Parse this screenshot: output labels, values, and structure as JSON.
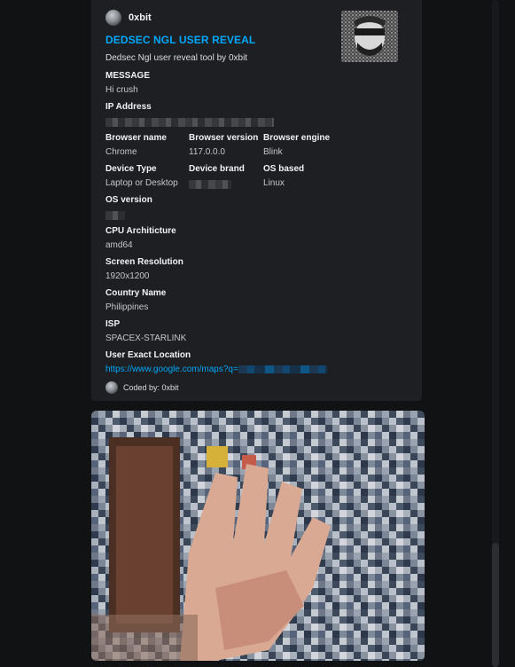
{
  "embed": {
    "author_name": "0xbit",
    "title": "DEDSEC NGL USER REVEAL",
    "description": "Dedsec Ngl user reveal tool by 0xbit",
    "fields": {
      "message": {
        "name": "MESSAGE",
        "value": "Hi crush"
      },
      "ip_address": {
        "name": "IP Address",
        "value": ""
      },
      "browser_name": {
        "name": "Browser name",
        "value": "Chrome"
      },
      "browser_version": {
        "name": "Browser version",
        "value": "117.0.0.0"
      },
      "browser_engine": {
        "name": "Browser engine",
        "value": "Blink"
      },
      "device_type": {
        "name": "Device Type",
        "value": "Laptop or Desktop"
      },
      "device_brand": {
        "name": "Device brand",
        "value": ""
      },
      "os_based": {
        "name": "OS based",
        "value": "Linux"
      },
      "os_version": {
        "name": "OS version",
        "value": ""
      },
      "cpu_architecture": {
        "name": "CPU Architicture",
        "value": "amd64"
      },
      "screen_resolution": {
        "name": "Screen Resolution",
        "value": "1920x1200"
      },
      "country_name": {
        "name": "Country Name",
        "value": "Philippines"
      },
      "isp": {
        "name": "ISP",
        "value": "SPACEX-STARLINK"
      },
      "user_exact_location": {
        "name": "User Exact Location",
        "value": "https://www.google.com/maps?q="
      }
    },
    "footer_text": "Coded by: 0xbit"
  },
  "icons": {
    "author_avatar": "avatar-icon",
    "footer_avatar": "avatar-icon"
  },
  "colors": {
    "background": "#111214",
    "embed_background": "#1e1f22",
    "title_link": "#00a8fc",
    "text_primary": "#f2f3f5",
    "text_secondary": "#c4c7cc"
  }
}
